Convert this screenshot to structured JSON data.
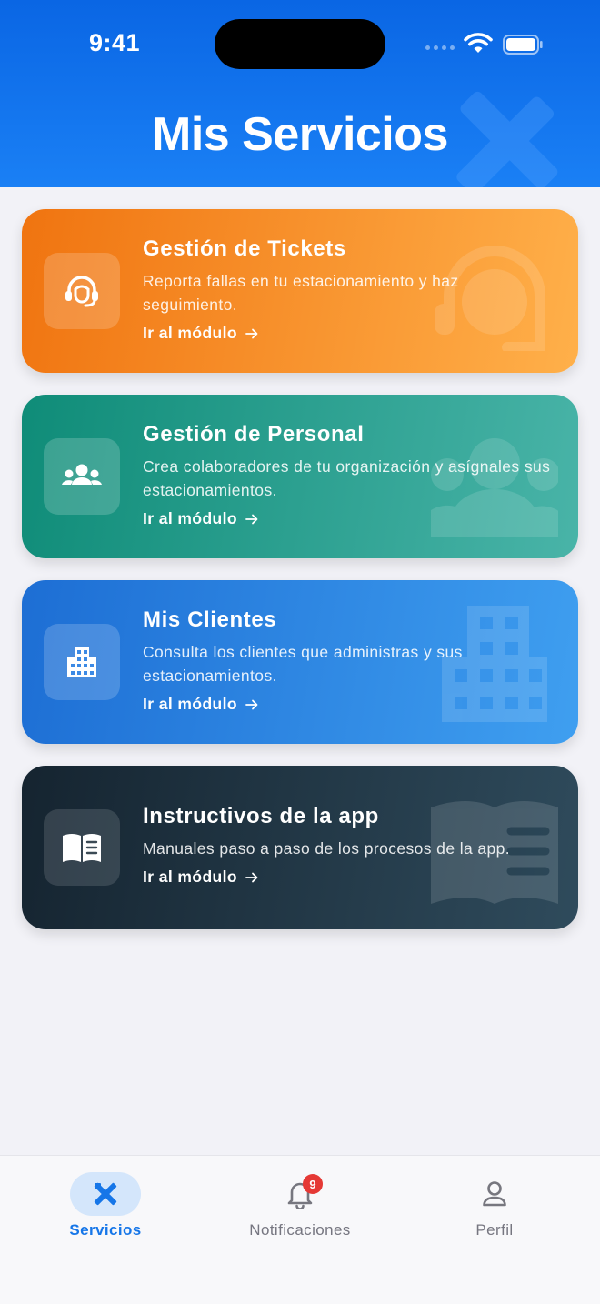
{
  "status_bar": {
    "time": "9:41"
  },
  "header": {
    "title": "Mis Servicios"
  },
  "cards": [
    {
      "title": "Gestión de Tickets",
      "description": "Reporta fallas en tu estacionamiento y haz seguimiento.",
      "link": "Ir al módulo",
      "icon": "headset-icon",
      "color": "#f07410"
    },
    {
      "title": "Gestión de Personal",
      "description": "Crea colaboradores de tu organización y asígnales sus estacionamientos.",
      "link": "Ir al módulo",
      "icon": "group-icon",
      "color": "#0f8c78"
    },
    {
      "title": "Mis Clientes",
      "description": "Consulta los clientes que administras y sus estacionamientos.",
      "link": "Ir al módulo",
      "icon": "building-icon",
      "color": "#1d6ed4"
    },
    {
      "title": "Instructivos de la app",
      "description": "Manuales paso a paso de los procesos de la app.",
      "link": "Ir al módulo",
      "icon": "book-icon",
      "color": "#152430"
    }
  ],
  "bottom_nav": {
    "items": [
      {
        "label": "Servicios",
        "icon": "tools-icon",
        "active": true
      },
      {
        "label": "Notificaciones",
        "icon": "bell-icon",
        "badge": "9"
      },
      {
        "label": "Perfil",
        "icon": "person-icon"
      }
    ],
    "accent": "#1676e8"
  }
}
